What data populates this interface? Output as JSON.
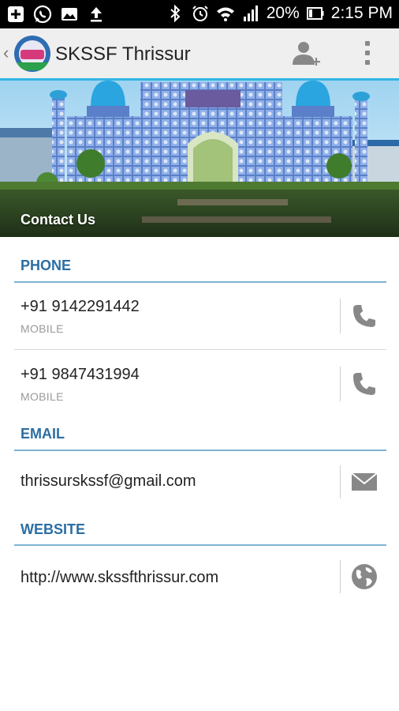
{
  "status_bar": {
    "battery": "20%",
    "time": "2:15 PM"
  },
  "action_bar": {
    "title": "SKSSF Thrissur"
  },
  "banner": {
    "caption": "Contact Us"
  },
  "sections": {
    "phone": {
      "header": "PHONE",
      "entries": [
        {
          "number": "+91 9142291442",
          "type": "MOBILE"
        },
        {
          "number": "+91 9847431994",
          "type": "MOBILE"
        }
      ]
    },
    "email": {
      "header": "EMAIL",
      "address": "thrissurskssf@gmail.com"
    },
    "website": {
      "header": "WEBSITE",
      "url": "http://www.skssfthrissur.com"
    }
  },
  "colors": {
    "accent": "#33b5e5",
    "section_header": "#2c6ea3",
    "icon_gray": "#888888"
  }
}
